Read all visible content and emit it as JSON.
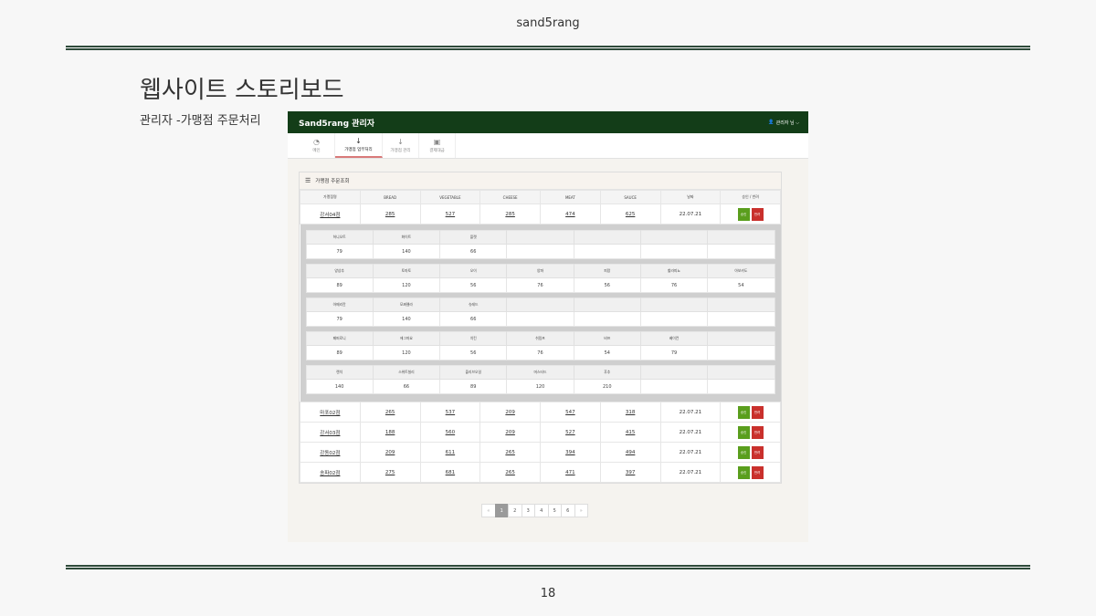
{
  "slide": {
    "header": "sand5rang",
    "title": "웹사이트 스토리보드",
    "subtitle": "관리자 -가맹점 주문처리",
    "page_number": "18"
  },
  "app": {
    "brand": "Sand5rang 관리자",
    "user_label": "관리자 님 ⌵",
    "nav": [
      {
        "label": "메인",
        "icon": "dashboard-icon"
      },
      {
        "label": "가맹점 업무처리",
        "icon": "download-arrow-icon"
      },
      {
        "label": "가맹점 관리",
        "icon": "download-arrow-icon"
      },
      {
        "label": "결제대금",
        "icon": "money-icon"
      }
    ],
    "panel_title": "가맹점 주문조회",
    "order_columns": [
      "가맹점명",
      "BREAD",
      "VEGETABLE",
      "CHEESE",
      "MEAT",
      "SAUCE",
      "날짜",
      "승인 / 반려"
    ],
    "first_order": {
      "store": "강서04점",
      "bread": "285",
      "vegetable": "527",
      "cheese": "285",
      "meat": "474",
      "sauce": "625",
      "date": "22.07.21"
    },
    "detail_groups": [
      {
        "headers": [
          "허니오트",
          "화이트",
          "플랫",
          "",
          "",
          "",
          ""
        ],
        "values": [
          "79",
          "140",
          "66",
          "",
          "",
          "",
          ""
        ]
      },
      {
        "headers": [
          "양상추",
          "토마토",
          "오이",
          "양파",
          "피망",
          "할라피뇨",
          "아보카도"
        ],
        "values": [
          "89",
          "120",
          "56",
          "76",
          "56",
          "76",
          "54"
        ]
      },
      {
        "headers": [
          "아메리칸",
          "모짜렐라",
          "슈레드",
          "",
          "",
          "",
          ""
        ],
        "values": [
          "79",
          "140",
          "66",
          "",
          "",
          "",
          ""
        ]
      },
      {
        "headers": [
          "페퍼로니",
          "에그마요",
          "치킨",
          "쉬림프",
          "비프",
          "베이컨",
          ""
        ],
        "values": [
          "89",
          "120",
          "56",
          "76",
          "54",
          "79",
          ""
        ]
      },
      {
        "headers": [
          "랜치",
          "스위트칠리",
          "올리브오일",
          "머스타드",
          "후추",
          "",
          ""
        ],
        "values": [
          "140",
          "66",
          "89",
          "120",
          "210",
          "",
          ""
        ]
      }
    ],
    "other_orders": [
      {
        "store": "마포02점",
        "bread": "265",
        "vegetable": "537",
        "cheese": "209",
        "meat": "547",
        "sauce": "318",
        "date": "22.07.21"
      },
      {
        "store": "강서03점",
        "bread": "188",
        "vegetable": "560",
        "cheese": "209",
        "meat": "527",
        "sauce": "415",
        "date": "22.07.21"
      },
      {
        "store": "강동02점",
        "bread": "209",
        "vegetable": "611",
        "cheese": "265",
        "meat": "394",
        "sauce": "494",
        "date": "22.07.21"
      },
      {
        "store": "송파02점",
        "bread": "275",
        "vegetable": "681",
        "cheese": "265",
        "meat": "471",
        "sauce": "397",
        "date": "22.07.21"
      }
    ],
    "approve_label": "승인",
    "reject_label": "반려",
    "pagination": [
      "«",
      "1",
      "2",
      "3",
      "4",
      "5",
      "6",
      "»"
    ],
    "current_page": "1"
  },
  "colors": {
    "topbar": "#133d18",
    "approve": "#5a9e1d",
    "reject": "#c9302c",
    "rule": "#2e4a3a"
  }
}
